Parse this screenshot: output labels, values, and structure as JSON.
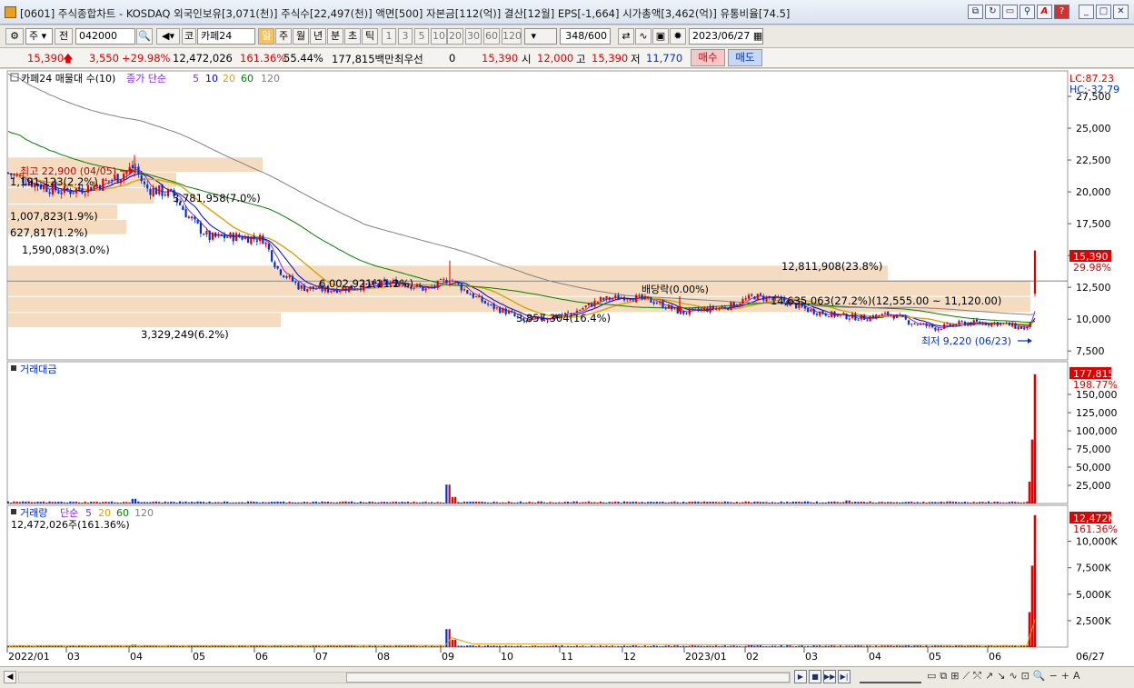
{
  "window": {
    "title": "[0601] 주식종합차트 - KOSDAQ 외국인보유[3,071(천)] 주식수[22,497(천)] 액면[500] 자본금[112(억)] 결산[12월] EPS[-1,664] 시가총액[3,462(억)] 유통비율[74.5]",
    "buttons": [
      "restore-icon",
      "refresh-icon",
      "window-icon",
      "pin-icon",
      "font-icon",
      "help-icon",
      "minimize-icon",
      "maximize-icon",
      "close-icon"
    ]
  },
  "toolbar": {
    "period_select": "주",
    "prev_label": "전",
    "code": "042000",
    "market_label": "코",
    "stock_name": "카페24",
    "period_tabs": [
      "일",
      "주",
      "월",
      "년",
      "분",
      "초",
      "틱"
    ],
    "interval_tabs": [
      "1",
      "3",
      "5",
      "10",
      "20",
      "30",
      "60",
      "120"
    ],
    "count": "348",
    "count_total": "/600",
    "date": "2023/06/27"
  },
  "quote": {
    "price": "15,390",
    "change": "3,550",
    "change_pct": "+29.98%",
    "volume": "12,472,026",
    "vol_ratio": "161.36%",
    "rate2": "55.44%",
    "amount": "177,815백만",
    "pref_label": "최우선",
    "pref_val": "0",
    "cur_price": "15,390",
    "open_label": "시",
    "open_val": "12,000",
    "high_label": "고",
    "high_val": "15,390",
    "low_label": "저",
    "low_val": "11,770",
    "buy_label": "매수",
    "sell_label": "매도"
  },
  "price_panel": {
    "legend_name": "카페24 매물대 수(10)",
    "legend_ma": "종가 단순",
    "ma_periods": [
      "5",
      "10",
      "20",
      "60",
      "120"
    ],
    "lc_label": "LC:87.23",
    "hc_label": "HC:-32.79",
    "y_ticks": [
      "27,500",
      "25,000",
      "22,500",
      "20,000",
      "17,500",
      "15,000",
      "12,500",
      "10,000",
      "7,500"
    ],
    "last_price_tag": "15,390",
    "last_pct_tag": "29.98%",
    "high_annotation": "최고 22,900 (04/05)",
    "low_annotation": "최저 9,220 (06/23)",
    "dividend_annotation": "배당락(0.00%)",
    "volume_profile_labels": [
      "12,811,908(23.8%)",
      "14,635,063(27.2%)(12,555.00 ~ 11,120.00)",
      "6,002,921(11.2%)",
      "3,857,304(16.4%)",
      "3,329,249(6.2%)",
      "1,590,083(3.0%)",
      "627,817(1.2%)",
      "1,007,823(1.9%)",
      "1,191,123(2.2%)",
      "3,781,958(7.0%)"
    ]
  },
  "amount_panel": {
    "legend": "거래대금",
    "y_ticks": [
      "150,000",
      "125,000",
      "100,000",
      "75,000",
      "50,000",
      "25,000"
    ],
    "last_tag": "177,815",
    "last_pct_tag": "198.77%"
  },
  "volume_panel": {
    "legend_name": "거래량",
    "legend_ma": "단순",
    "ma_periods": [
      "5",
      "20",
      "60",
      "120"
    ],
    "current": "12,472,026주(161.36%)",
    "y_ticks": [
      "10,000K",
      "7,500K",
      "5,000K",
      "2,500K"
    ],
    "last_tag": "12,472K",
    "last_pct_tag": "161.36%"
  },
  "x_axis": {
    "labels": [
      "2022/01",
      "03",
      "04",
      "05",
      "06",
      "07",
      "08",
      "09",
      "10",
      "11",
      "12",
      "2023/01",
      "02",
      "03",
      "04",
      "05",
      "06"
    ],
    "right_label": "06/27"
  },
  "colors": {
    "up": "#e00000",
    "down": "#0030d0",
    "ma5": "#8a2be2",
    "ma10": "#0000cc",
    "ma20": "#e0a000",
    "ma60": "#008000",
    "ma120": "#808080",
    "profile": "#f5dcc0"
  }
}
